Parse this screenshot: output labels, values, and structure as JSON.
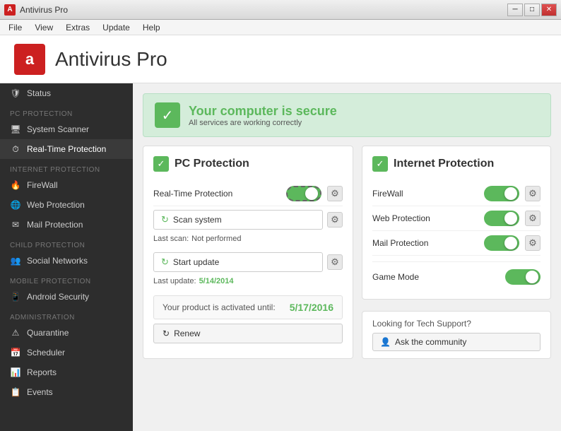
{
  "titleBar": {
    "icon": "A",
    "title": "Antivirus Pro",
    "minimizeLabel": "─",
    "maximizeLabel": "□",
    "closeLabel": "✕"
  },
  "menuBar": {
    "items": [
      "File",
      "View",
      "Extras",
      "Update",
      "Help"
    ]
  },
  "header": {
    "logoText": "a",
    "appTitle": "Antivirus Pro"
  },
  "sidebar": {
    "statusLabel": "Status",
    "pcProtectionSection": "PC PROTECTION",
    "systemScannerLabel": "System Scanner",
    "realtimeProtectionLabel": "Real-Time Protection",
    "internetProtectionSection": "INTERNET PROTECTION",
    "firewallLabel": "FireWall",
    "webProtectionLabel": "Web Protection",
    "mailProtectionLabel": "Mail Protection",
    "childProtectionSection": "CHILD PROTECTION",
    "socialNetworksLabel": "Social Networks",
    "mobileProtectionSection": "MOBILE PROTECTION",
    "androidSecurityLabel": "Android Security",
    "administrationSection": "ADMINISTRATION",
    "quarantineLabel": "Quarantine",
    "schedulerLabel": "Scheduler",
    "reportsLabel": "Reports",
    "eventsLabel": "Events"
  },
  "statusBanner": {
    "checkmark": "✓",
    "secure": "Your computer is secure",
    "subtitle": "All services are working correctly"
  },
  "pcProtection": {
    "checkmark": "✓",
    "title": "PC Protection",
    "realtimeLabel": "Real-Time Protection",
    "scanLabel": "Scan system",
    "lastScanText": "Last scan:",
    "lastScanValue": "Not performed",
    "updateLabel": "Start update",
    "lastUpdateText": "Last update:",
    "lastUpdateValue": "5/14/2014",
    "activatedText": "Your product is activated until:",
    "activatedDate": "5/17/2016",
    "renewLabel": "Renew",
    "scanIcon": "↻",
    "updateIcon": "↻",
    "renewIcon": "↻"
  },
  "internetProtection": {
    "checkmark": "✓",
    "title": "Internet Protection",
    "firewallLabel": "FireWall",
    "webProtectionLabel": "Web Protection",
    "mailProtectionLabel": "Mail Protection",
    "gameModeLabel": "Game Mode",
    "techSupportTitle": "Looking for Tech Support?",
    "communityLabel": "Ask the community",
    "communityIcon": "👤"
  }
}
